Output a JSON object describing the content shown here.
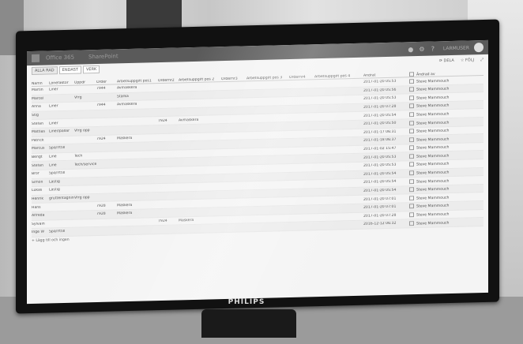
{
  "monitor": {
    "brand": "PHILIPS"
  },
  "suite": {
    "app": "Office 365",
    "site": "SharePoint",
    "user": "LARMUSER"
  },
  "tabs": [
    "ALLA RAD",
    "ENDAST",
    "VERK"
  ],
  "actions": {
    "edit": "DELA",
    "follow": "FÖLJ"
  },
  "columns": [
    "Namn",
    "Lonefaktor",
    "Uppdr",
    "Order",
    "Arbetsuppgift pos1",
    "Ordernr2",
    "Arbetsuppgift pos 2",
    "Ordernr3",
    "Arbetsuppgift pos 3",
    "Ordernr4",
    "Arbetsuppgift pos 4",
    "Ändrat",
    "Ändrad av"
  ],
  "rows": [
    [
      "Martin",
      "Liner",
      "",
      "7944",
      "Avmaskera",
      "",
      "",
      "",
      "",
      "",
      "",
      "2017-01-20 05:53",
      "Steve Mammouch"
    ],
    [
      "Marcel",
      "",
      "Vfrg",
      "",
      "Stärka",
      "",
      "",
      "",
      "",
      "",
      "",
      "2017-01-20 05:56",
      "Steve Mammouch"
    ],
    [
      "Anna",
      "Liner",
      "",
      "7944",
      "Avmaskera",
      "",
      "",
      "",
      "",
      "",
      "",
      "2017-01-20 05:53",
      "Steve Mammouch"
    ],
    [
      "Stig",
      "",
      "",
      "",
      "",
      "",
      "",
      "",
      "",
      "",
      "",
      "2017-01-20 07:28",
      "Steve Mammouch"
    ],
    [
      "Stefan",
      "Liner",
      "",
      "",
      "",
      "7924",
      "Avmaskera",
      "",
      "",
      "",
      "",
      "2017-01-20 05:54",
      "Steve Mammouch"
    ],
    [
      "Mattias",
      "Liner/pallar",
      "Vfrg opp",
      "",
      "",
      "",
      "",
      "",
      "",
      "",
      "",
      "2017-01-20 05:50",
      "Steve Mammouch"
    ],
    [
      "Patrick",
      "",
      "",
      "7924",
      "Maskera",
      "",
      "",
      "",
      "",
      "",
      "",
      "2017-01-17 06:31",
      "Steve Mammouch"
    ],
    [
      "Marcus",
      "Spa/Yttill",
      "",
      "",
      "",
      "",
      "",
      "",
      "",
      "",
      "",
      "2017-01-18 06:37",
      "Steve Mammouch"
    ],
    [
      "Bengt",
      "Line",
      "Tech",
      "",
      "",
      "",
      "",
      "",
      "",
      "",
      "",
      "2017-01-02 15:47",
      "Steve Mammouch"
    ],
    [
      "Stefan",
      "Line",
      "Tech/service",
      "",
      "",
      "",
      "",
      "",
      "",
      "",
      "",
      "2017-01-20 05:53",
      "Steve Mammouch"
    ],
    [
      "Bror",
      "Spa/Yttill",
      "",
      "",
      "",
      "",
      "",
      "",
      "",
      "",
      "",
      "2017-01-20 05:53",
      "Steve Mammouch"
    ],
    [
      "Simon",
      "Lastig",
      "",
      "",
      "",
      "",
      "",
      "",
      "",
      "",
      "",
      "2017-01-20 05:54",
      "Steve Mammouch"
    ],
    [
      "Lukas",
      "Lastig",
      "",
      "",
      "",
      "",
      "",
      "",
      "",
      "",
      "",
      "2017-01-20 05:54",
      "Steve Mammouch"
    ],
    [
      "Henrik",
      "gruttentagning",
      "Vfrg opp",
      "",
      "",
      "",
      "",
      "",
      "",
      "",
      "",
      "2017-01-20 05:54",
      "Steve Mammouch"
    ],
    [
      "Hans",
      "",
      "",
      "7928",
      "Maskera",
      "",
      "",
      "",
      "",
      "",
      "",
      "2017-01-20 07:01",
      "Steve Mammouch"
    ],
    [
      "Alfreda",
      "",
      "",
      "7928",
      "Maskera",
      "",
      "",
      "",
      "",
      "",
      "",
      "2017-01-20 07:01",
      "Steve Mammouch"
    ],
    [
      "Sylvain",
      "",
      "",
      "",
      "",
      "7924",
      "Maskera",
      "",
      "",
      "",
      "",
      "2017-01-20 07:28",
      "Steve Mammouch"
    ],
    [
      "Inge W",
      "Spa/Yttill",
      "",
      "",
      "",
      "",
      "",
      "",
      "",
      "",
      "",
      "2016-12-12 06:32",
      "Steve Mammouch"
    ]
  ],
  "add_row": "Lägg till och ingen"
}
